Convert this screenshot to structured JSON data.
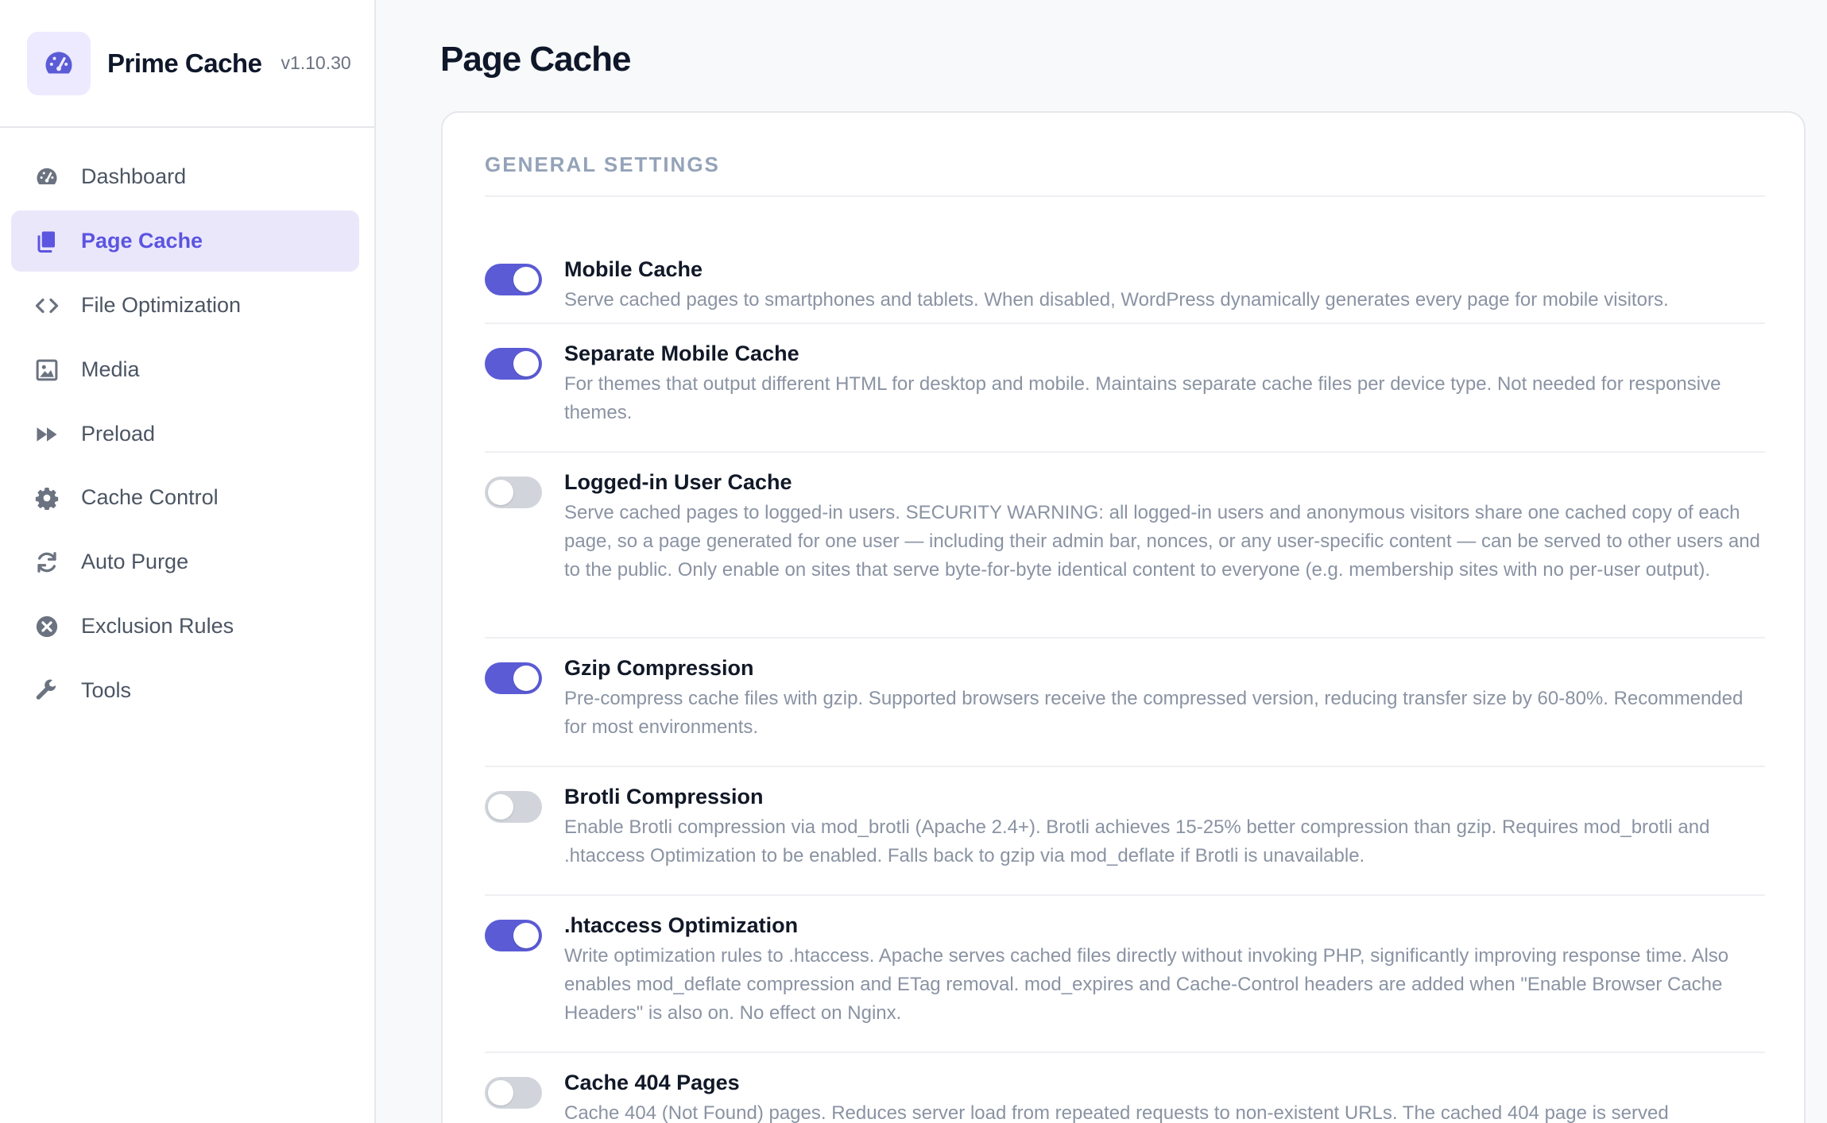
{
  "brand": {
    "name": "Prime Cache",
    "version": "v1.10.30",
    "logo_icon": "speedometer-icon",
    "accent": "#5b5bd6"
  },
  "sidebar": {
    "items": [
      {
        "label": "Dashboard",
        "icon": "dashboard-icon",
        "active": false
      },
      {
        "label": "Page Cache",
        "icon": "pages-icon",
        "active": true
      },
      {
        "label": "File Optimization",
        "icon": "code-icon",
        "active": false
      },
      {
        "label": "Media",
        "icon": "image-icon",
        "active": false
      },
      {
        "label": "Preload",
        "icon": "fast-forward-icon",
        "active": false
      },
      {
        "label": "Cache Control",
        "icon": "gear-icon",
        "active": false
      },
      {
        "label": "Auto Purge",
        "icon": "refresh-icon",
        "active": false
      },
      {
        "label": "Exclusion Rules",
        "icon": "x-circle-icon",
        "active": false
      },
      {
        "label": "Tools",
        "icon": "wrench-icon",
        "active": false
      }
    ]
  },
  "main": {
    "title": "Page Cache",
    "section_title": "General Settings",
    "settings": [
      {
        "title": "Mobile Cache",
        "enabled": true,
        "description": "Serve cached pages to smartphones and tablets. When disabled, WordPress dynamically generates every page for mobile visitors."
      },
      {
        "title": "Separate Mobile Cache",
        "enabled": true,
        "description": "For themes that output different HTML for desktop and mobile. Maintains separate cache files per device type. Not needed for responsive themes."
      },
      {
        "title": "Logged-in User Cache",
        "enabled": false,
        "description": "Serve cached pages to logged-in users. SECURITY WARNING: all logged-in users and anonymous visitors share one cached copy of each page, so a page generated for one user — including their admin bar, nonces, or any user-specific content — can be served to other users and to the public. Only enable on sites that serve byte-for-byte identical content to everyone (e.g. membership sites with no per-user output)."
      },
      {
        "title": "Gzip Compression",
        "enabled": true,
        "description": "Pre-compress cache files with gzip. Supported browsers receive the compressed version, reducing transfer size by 60-80%. Recommended for most environments."
      },
      {
        "title": "Brotli Compression",
        "enabled": false,
        "description": "Enable Brotli compression via mod_brotli (Apache 2.4+). Brotli achieves 15-25% better compression than gzip. Requires mod_brotli and .htaccess Optimization to be enabled. Falls back to gzip via mod_deflate if Brotli is unavailable."
      },
      {
        "title": ".htaccess Optimization",
        "enabled": true,
        "description": "Write optimization rules to .htaccess. Apache serves cached files directly without invoking PHP, significantly improving response time. Also enables mod_deflate compression and ETag removal. mod_expires and Cache-Control headers are added when \"Enable Browser Cache Headers\" is also on. No effect on Nginx."
      },
      {
        "title": "Cache 404 Pages",
        "enabled": false,
        "description": "Cache 404 (Not Found) pages. Reduces server load from repeated requests to non-existent URLs. The cached 404 page is served"
      }
    ]
  }
}
